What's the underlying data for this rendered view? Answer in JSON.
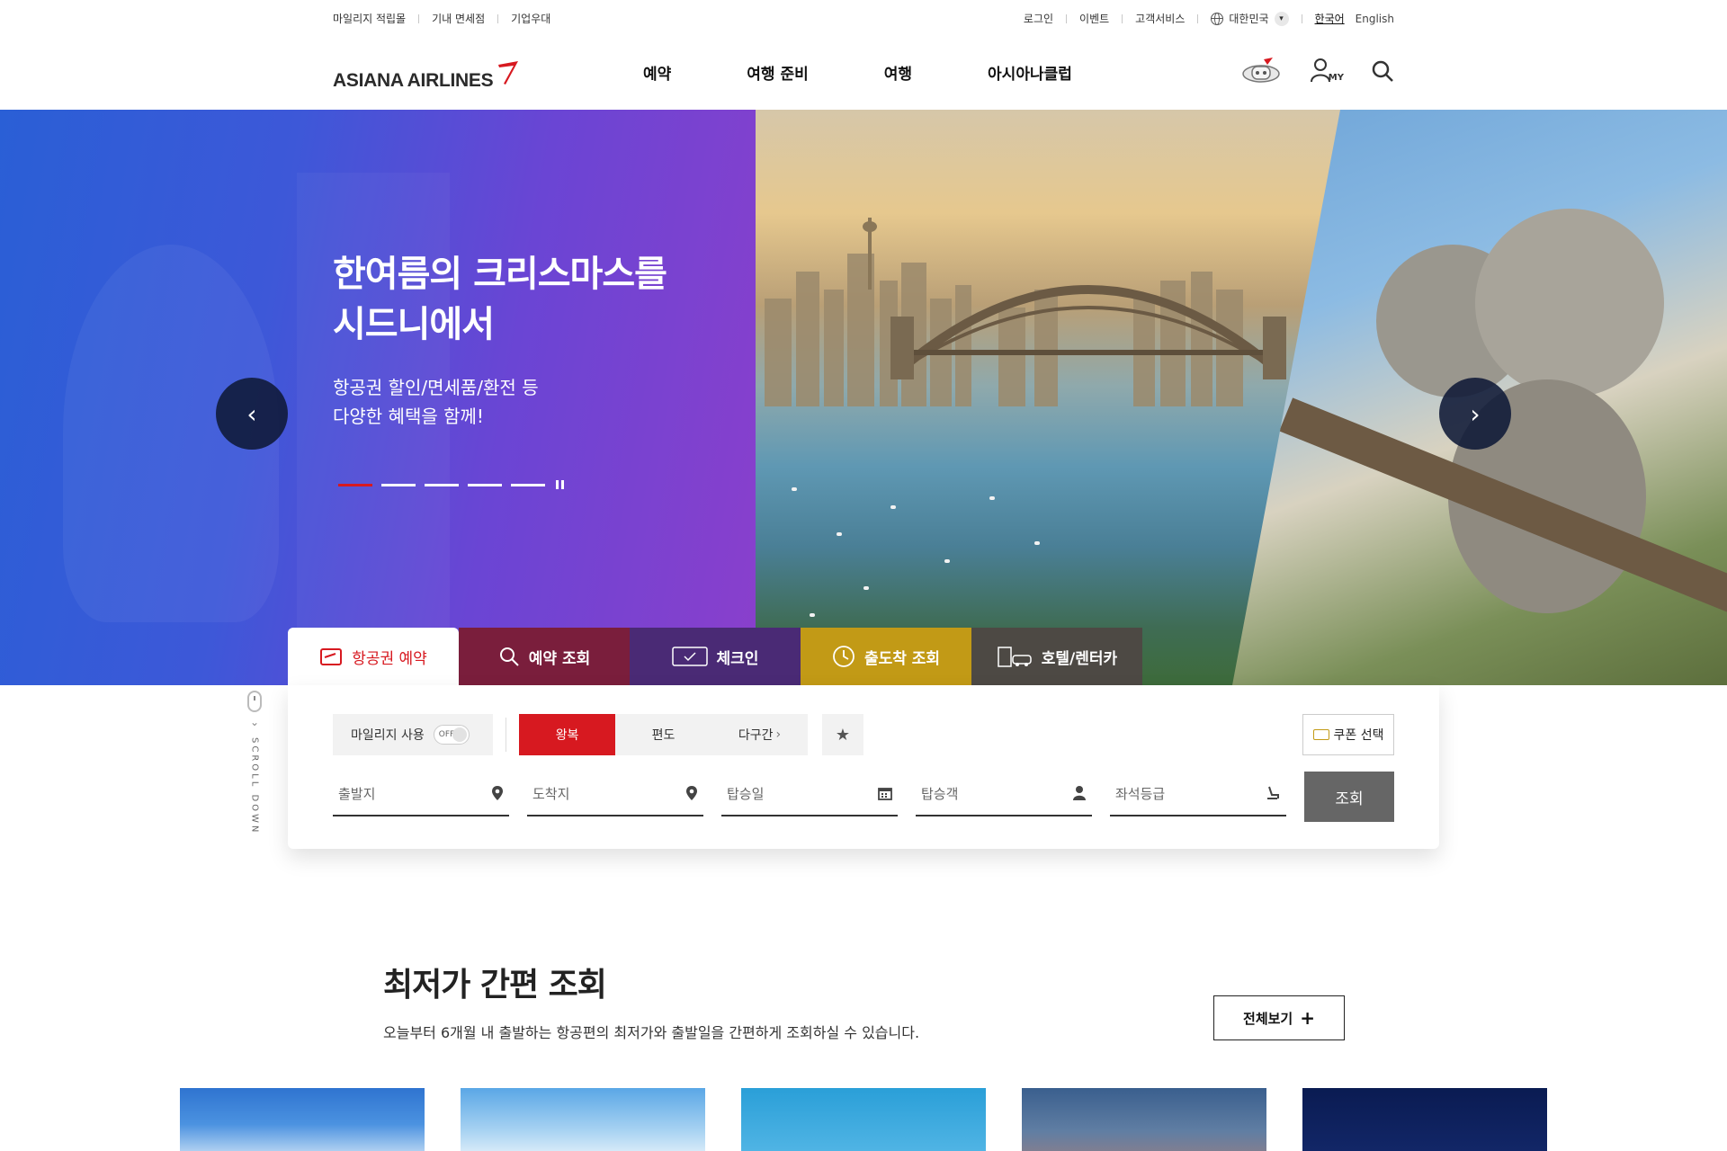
{
  "util": {
    "left_links": [
      "마일리지 적립몰",
      "기내 면세점",
      "기업우대"
    ],
    "right_links": [
      "로그인",
      "이벤트",
      "고객서비스"
    ],
    "region": "대한민국",
    "lang_ko": "한국어",
    "lang_en": "English"
  },
  "header": {
    "logo_text": "ASIANA AIRLINES",
    "nav": [
      "예약",
      "여행 준비",
      "여행",
      "아시아나클럽"
    ],
    "my_label": "MY"
  },
  "hero": {
    "title_line1": "한여름의 크리스마스를",
    "title_line2": "시드니에서",
    "sub_line1": "항공권 할인/면세품/환전 등",
    "sub_line2": "다양한 혜택을 함께!",
    "slide_count": 5,
    "active_slide": 1
  },
  "booking": {
    "tabs": [
      "항공권 예약",
      "예약 조회",
      "체크인",
      "출도착 조회",
      "호텔/렌터카"
    ],
    "active_tab": "항공권 예약",
    "mileage_label": "마일리지 사용",
    "toggle_state": "OFF",
    "trip_types": [
      "왕복",
      "편도",
      "다구간"
    ],
    "active_trip": "왕복",
    "coupon_label": "쿠폰 선택",
    "fields": {
      "origin": "출발지",
      "destination": "도착지",
      "date": "탑승일",
      "passengers": "탑승객",
      "cabin": "좌석등급"
    },
    "search_label": "조회"
  },
  "scroll_text": "SCROLL DOWN",
  "lowest_fare": {
    "title": "최저가 간편 조회",
    "description": "오늘부터 6개월 내 출발하는 항공편의 최저가와 출발일을 간편하게 조회하실 수 있습니다.",
    "more_label": "전체보기"
  },
  "colors": {
    "brand_red": "#d71920",
    "tab_booking_lookup": "#7a1e3c",
    "tab_checkin": "#4a2a75",
    "tab_arrival": "#c29a16",
    "tab_hotel": "#4d4944"
  }
}
